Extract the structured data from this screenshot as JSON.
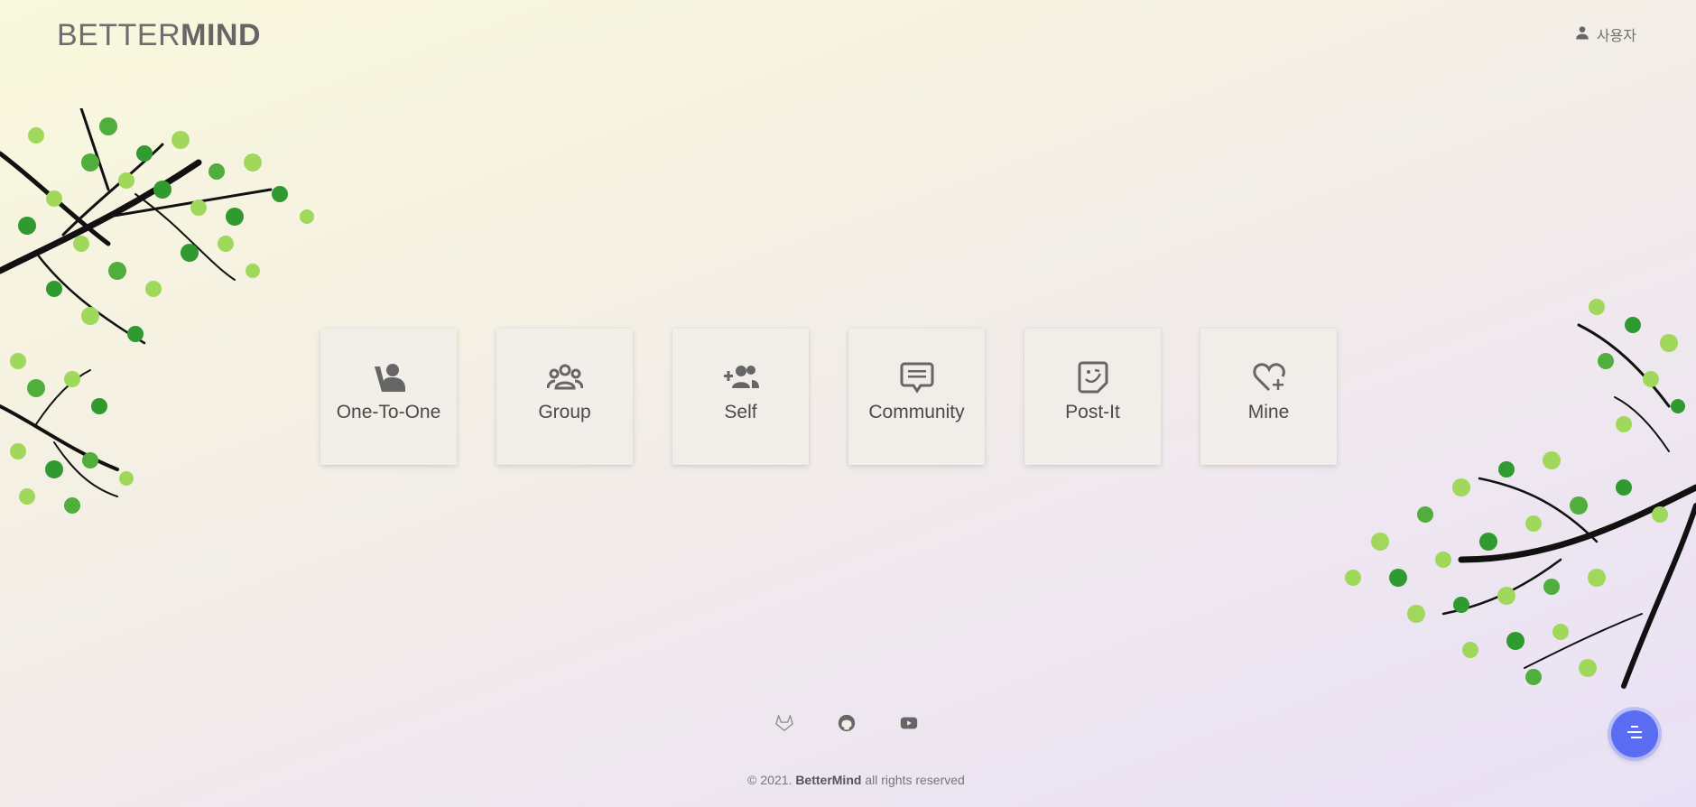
{
  "brand": {
    "light": "BETTER",
    "bold": "MIND"
  },
  "user": {
    "label": "사용자",
    "icon": "person-icon"
  },
  "cards": [
    {
      "label": "One-To-One",
      "icon": "person-one-to-one-icon"
    },
    {
      "label": "Group",
      "icon": "group-icon"
    },
    {
      "label": "Self",
      "icon": "person-add-icon"
    },
    {
      "label": "Community",
      "icon": "chat-bubble-icon"
    },
    {
      "label": "Post-It",
      "icon": "sticky-note-icon"
    },
    {
      "label": "Mine",
      "icon": "heart-plus-icon"
    }
  ],
  "social": [
    {
      "name": "gitlab",
      "icon": "gitlab-icon"
    },
    {
      "name": "github",
      "icon": "github-icon"
    },
    {
      "name": "youtube",
      "icon": "youtube-icon"
    }
  ],
  "footer": {
    "prefix": "© 2021.",
    "brand": "BetterMind",
    "suffix": "all rights reserved"
  },
  "colors": {
    "accent": "#5a6cf2",
    "text": "#4a4a4a",
    "leaf_dark": "#2f9a2f",
    "leaf_light": "#9fd85a"
  }
}
